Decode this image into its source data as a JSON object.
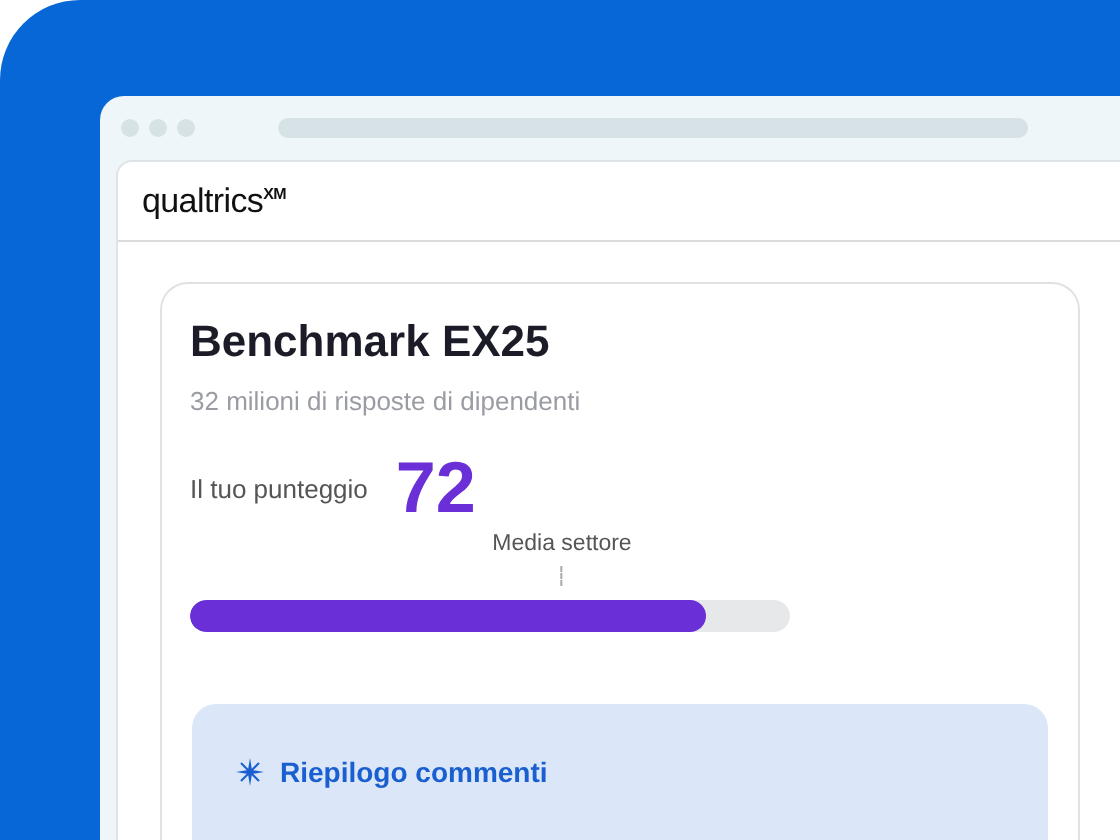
{
  "logo": {
    "name": "qualtrics",
    "mark": "XM"
  },
  "card": {
    "title": "Benchmark EX25",
    "subtitle": "32 milioni di risposte di dipendenti",
    "score_label": "Il tuo punteggio",
    "score": "72",
    "benchmark": {
      "label": "Media settore"
    },
    "progress": {
      "level": 0.86
    }
  },
  "comments": {
    "title": "Riepilogo commenti"
  }
}
